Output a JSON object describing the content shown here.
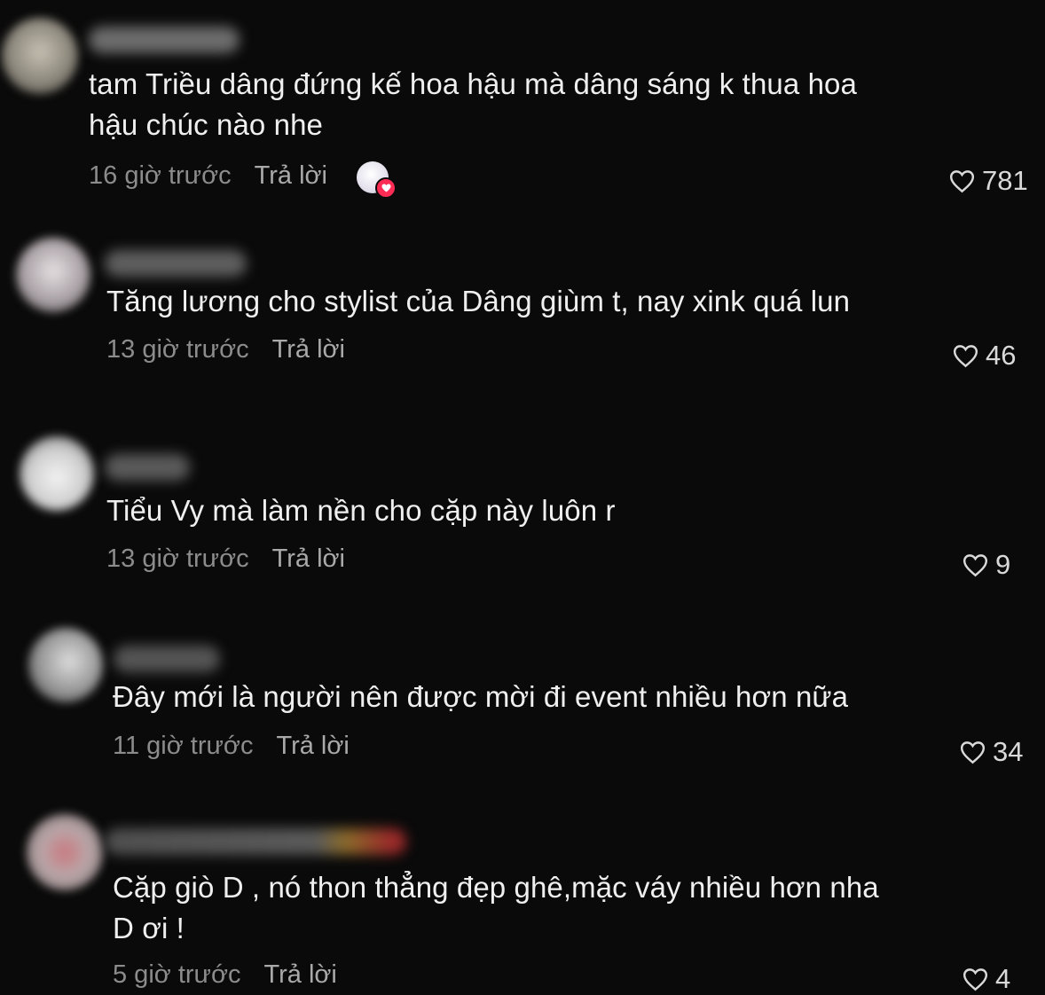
{
  "icons": {
    "like": "heart-outline-icon",
    "creator_badge": "heart-badge-icon"
  },
  "colors": {
    "background": "#0a0a0a",
    "text": "#efefef",
    "meta": "#8c8c8c",
    "badge": "#fe2c55"
  },
  "comments": [
    {
      "lines": [
        "tam Triều dâng đứng kế hoa hậu mà dâng sáng k thua hoa",
        "hậu chúc nào nhe"
      ],
      "time": "16 giờ trước",
      "reply": "Trả lời",
      "likes": "781",
      "liked_by_creator": true
    },
    {
      "lines": [
        "Tăng lương cho stylist của Dâng giùm t, nay xink quá lun"
      ],
      "time": "13 giờ trước",
      "reply": "Trả lời",
      "likes": "46"
    },
    {
      "lines": [
        "Tiểu Vy mà làm nền cho cặp này luôn r"
      ],
      "time": "13 giờ trước",
      "reply": "Trả lời",
      "likes": "9"
    },
    {
      "lines": [
        "Đây mới là người nên được mời đi event nhiều hơn nữa"
      ],
      "time": "11 giờ trước",
      "reply": "Trả lời",
      "likes": "34"
    },
    {
      "lines": [
        "Cặp giò D , nó thon thẳng đẹp ghê,mặc váy nhiều hơn nha",
        "D ơi !"
      ],
      "time": "5 giờ trước",
      "reply": "Trả lời",
      "likes": "4"
    }
  ]
}
